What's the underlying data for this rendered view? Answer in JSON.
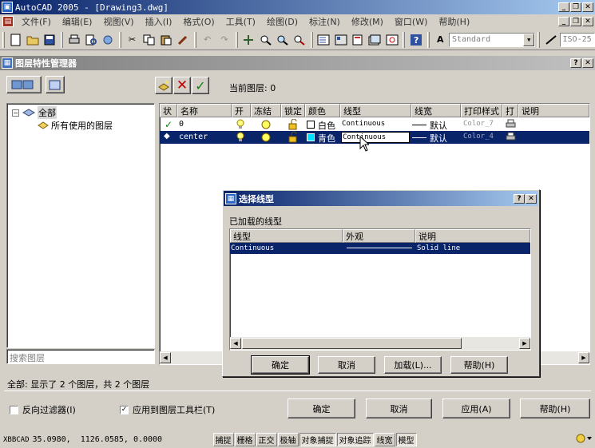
{
  "app": {
    "title": "AutoCAD 2005 - [Drawing3.dwg]",
    "menus": [
      "文件(F)",
      "编辑(E)",
      "视图(V)",
      "插入(I)",
      "格式(O)",
      "工具(T)",
      "绘图(D)",
      "标注(N)",
      "修改(M)",
      "窗口(W)",
      "帮助(H)"
    ],
    "text_style": "Standard",
    "dim_style": "ISO-25"
  },
  "layer_manager": {
    "title": "图层特性管理器",
    "current_layer_label": "当前图层: 0",
    "tree": {
      "root": "全部",
      "child": "所有使用的图层"
    },
    "search_placeholder": "搜索图层",
    "columns": [
      "状",
      "名称",
      "开",
      "冻结",
      "锁定",
      "颜色",
      "线型",
      "线宽",
      "打印样式",
      "打",
      "说明"
    ],
    "rows": [
      {
        "status": "✓",
        "name": "0",
        "color_name": "白色",
        "color_hex": "#ffffff",
        "linetype": "Continuous",
        "lineweight": "默认",
        "plot_style": "Color_7"
      },
      {
        "status": "◆",
        "name": "center",
        "color_name": "青色",
        "color_hex": "#00e0ff",
        "linetype": "Continuous",
        "lineweight": "默认",
        "plot_style": "Color_4"
      }
    ],
    "summary": "全部: 显示了 2 个图层，共 2 个图层",
    "invert_filter_label": "反向过滤器(I)",
    "apply_toolbar_label": "应用到图层工具栏(T)",
    "buttons": {
      "ok": "确定",
      "cancel": "取消",
      "apply": "应用(A)",
      "help": "帮助(H)"
    }
  },
  "linetype_dialog": {
    "title": "选择线型",
    "loaded_label": "已加载的线型",
    "columns": [
      "线型",
      "外观",
      "说明"
    ],
    "rows": [
      {
        "name": "Continuous",
        "description": "Solid line"
      }
    ],
    "buttons": {
      "ok": "确定",
      "cancel": "取消",
      "load": "加载(L)...",
      "help": "帮助(H)"
    }
  },
  "status": {
    "app_name": "XBBCAD",
    "coords": "35.0980,  1126.0585, 0.0000",
    "toggles": [
      {
        "label": "捕捉",
        "on": false
      },
      {
        "label": "栅格",
        "on": false
      },
      {
        "label": "正交",
        "on": false
      },
      {
        "label": "极轴",
        "on": false
      },
      {
        "label": "对象捕捉",
        "on": true
      },
      {
        "label": "对象追踪",
        "on": true
      },
      {
        "label": "线宽",
        "on": false
      },
      {
        "label": "模型",
        "on": true
      }
    ]
  }
}
